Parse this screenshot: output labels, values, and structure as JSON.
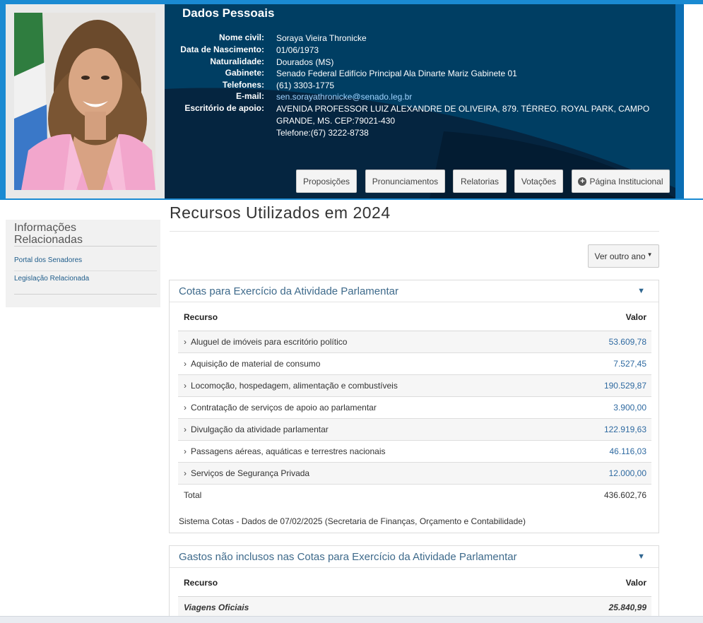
{
  "header": {
    "title": "Dados Pessoais",
    "fields": [
      {
        "label": "Nome civil:",
        "value": "Soraya Vieira Thronicke"
      },
      {
        "label": "Data de Nascimento:",
        "value": "01/06/1973"
      },
      {
        "label": "Naturalidade:",
        "value": "Dourados (MS)"
      },
      {
        "label": "Gabinete:",
        "value": "Senado Federal Edifício Principal Ala Dinarte Mariz Gabinete 01"
      },
      {
        "label": "Telefones:",
        "value": "(61) 3303-1775"
      },
      {
        "label": "E-mail:",
        "value": "sen.sorayathronicke@senado.leg.br"
      },
      {
        "label": "Escritório de apoio:",
        "value_lines": [
          "AVENIDA PROFESSOR LUIZ ALEXANDRE DE OLIVEIRA, 879. TÉRREO. ROYAL PARK, CAMPO",
          "GRANDE, MS. CEP:79021-430",
          "Telefone:(67) 3222-8738"
        ]
      }
    ],
    "buttons": {
      "proposicoes": "Proposições",
      "pronunciamentos": "Pronunciamentos",
      "relatorias": "Relatorias",
      "votacoes": "Votações",
      "pagina_institucional": "Página Institucional"
    }
  },
  "sidebar": {
    "title_line1": "Informações",
    "title_line2": "Relacionadas",
    "links": [
      "Portal dos Senadores",
      "Legislação Relacionada"
    ]
  },
  "main": {
    "title": "Recursos Utilizados em 2024",
    "ver_outro_ano": "Ver outro ano",
    "cotas": {
      "title": "Cotas para Exercício da Atividade Parlamentar",
      "col_recurso": "Recurso",
      "col_valor": "Valor",
      "rows": [
        {
          "label": "Aluguel de imóveis para escritório político",
          "value": "53.609,78"
        },
        {
          "label": "Aquisição de material de consumo",
          "value": "7.527,45"
        },
        {
          "label": "Locomoção, hospedagem, alimentação e combustíveis",
          "value": "190.529,87"
        },
        {
          "label": "Contratação de serviços de apoio ao parlamentar",
          "value": "3.900,00"
        },
        {
          "label": "Divulgação da atividade parlamentar",
          "value": "122.919,63"
        },
        {
          "label": "Passagens aéreas, aquáticas e terrestres nacionais",
          "value": "46.116,03"
        },
        {
          "label": "Serviços de Segurança Privada",
          "value": "12.000,00"
        }
      ],
      "total_label": "Total",
      "total_value": "436.602,76",
      "note": "Sistema Cotas - Dados de 07/02/2025 (Secretaria de Finanças, Orçamento e Contabilidade)"
    },
    "gastos": {
      "title": "Gastos não inclusos nas Cotas para Exercício da Atividade Parlamentar",
      "col_recurso": "Recurso",
      "col_valor": "Valor",
      "rows": [
        {
          "label": "Viagens Oficiais",
          "value": "25.840,99"
        }
      ]
    }
  },
  "icons": {
    "expand": "triangle-down-icon",
    "row": "chevron-right-icon",
    "plus": "plus-circle-icon"
  },
  "colors": {
    "banner_dark": "#003e63",
    "banner_accent": "#1a8ad2",
    "link": "#2f6aa1"
  }
}
